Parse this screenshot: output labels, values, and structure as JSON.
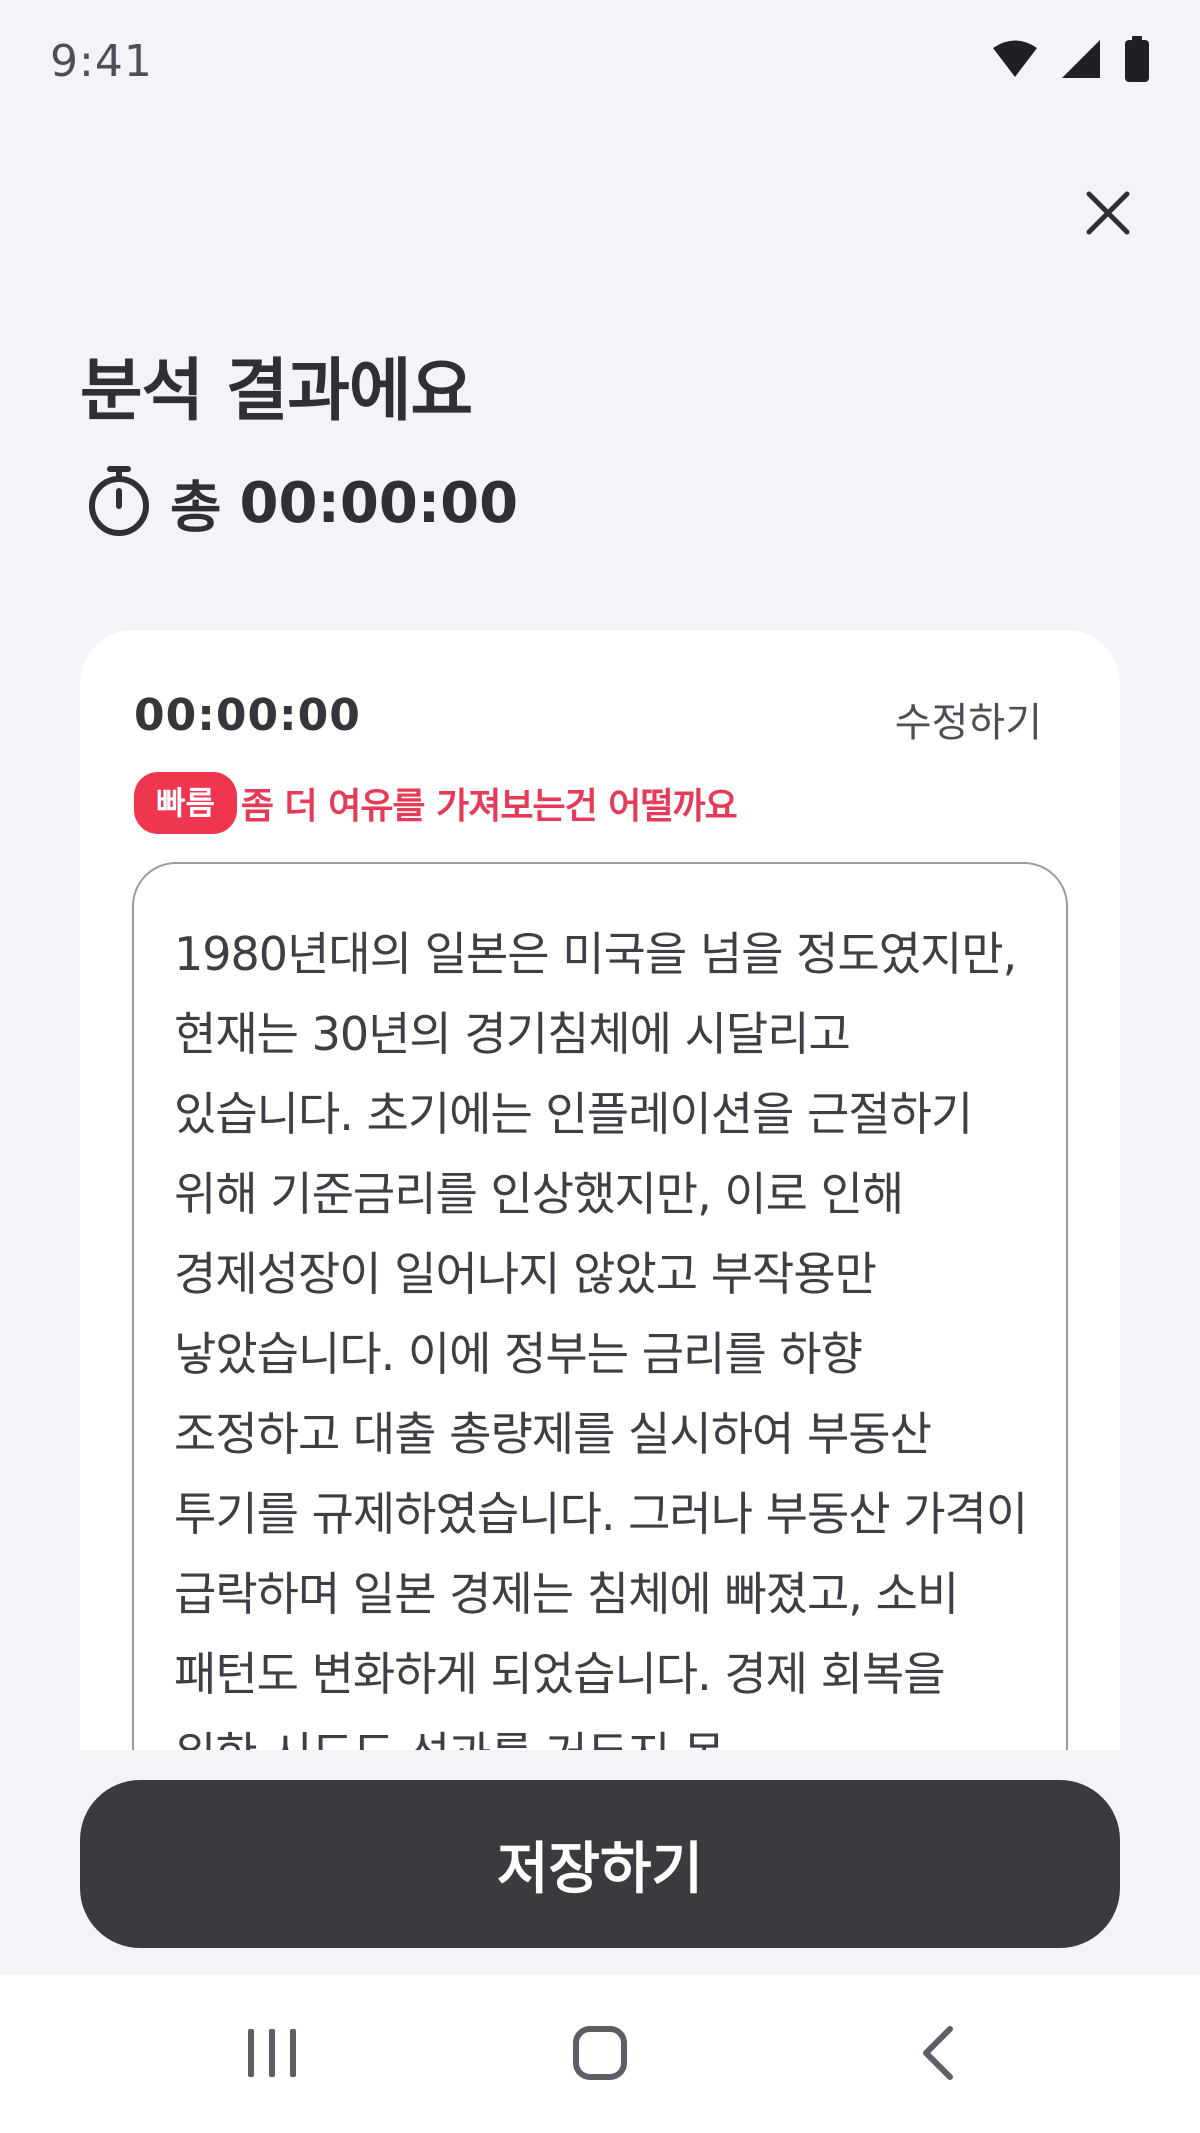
{
  "status_bar": {
    "time": "9:41",
    "icons": [
      "wifi-icon",
      "signal-icon",
      "battery-icon"
    ]
  },
  "header": {
    "close_icon": "close-icon",
    "title": "분석 결과에요",
    "total_label": "총",
    "total_time": "00:00:00",
    "timer_icon": "stopwatch-icon"
  },
  "card": {
    "time": "00:00:00",
    "edit_label": "수정하기",
    "speed_badge": "빠름",
    "speed_message": "좀 더 여유를 가져보는건 어떨까요",
    "text": "1980년대의 일본은 미국을 넘을 정도였지만, 현재는 30년의 경기침체에 시달리고 있습니다. 초기에는 인플레이션을 근절하기 위해 기준금리를 인상했지만, 이로 인해 경제성장이 일어나지 않았고 부작용만 낳았습니다. 이에 정부는 금리를 하향 조정하고 대출 총량제를 실시하여 부동산 투기를 규제하였습니다. 그러나 부동산 가격이 급락하며 일본 경제는 침체에 빠졌고, 소비 패턴도 변화하게 되었습니다. 경제 회복을 위한 시도도 성과를 거두지 못"
  },
  "footer": {
    "save_label": "저장하기"
  },
  "nav": {
    "items": [
      "recent-apps-icon",
      "home-icon",
      "back-icon"
    ]
  },
  "colors": {
    "background": "#f3f4f8",
    "accent_red": "#f0364f",
    "button_dark": "#3a3b3e"
  }
}
